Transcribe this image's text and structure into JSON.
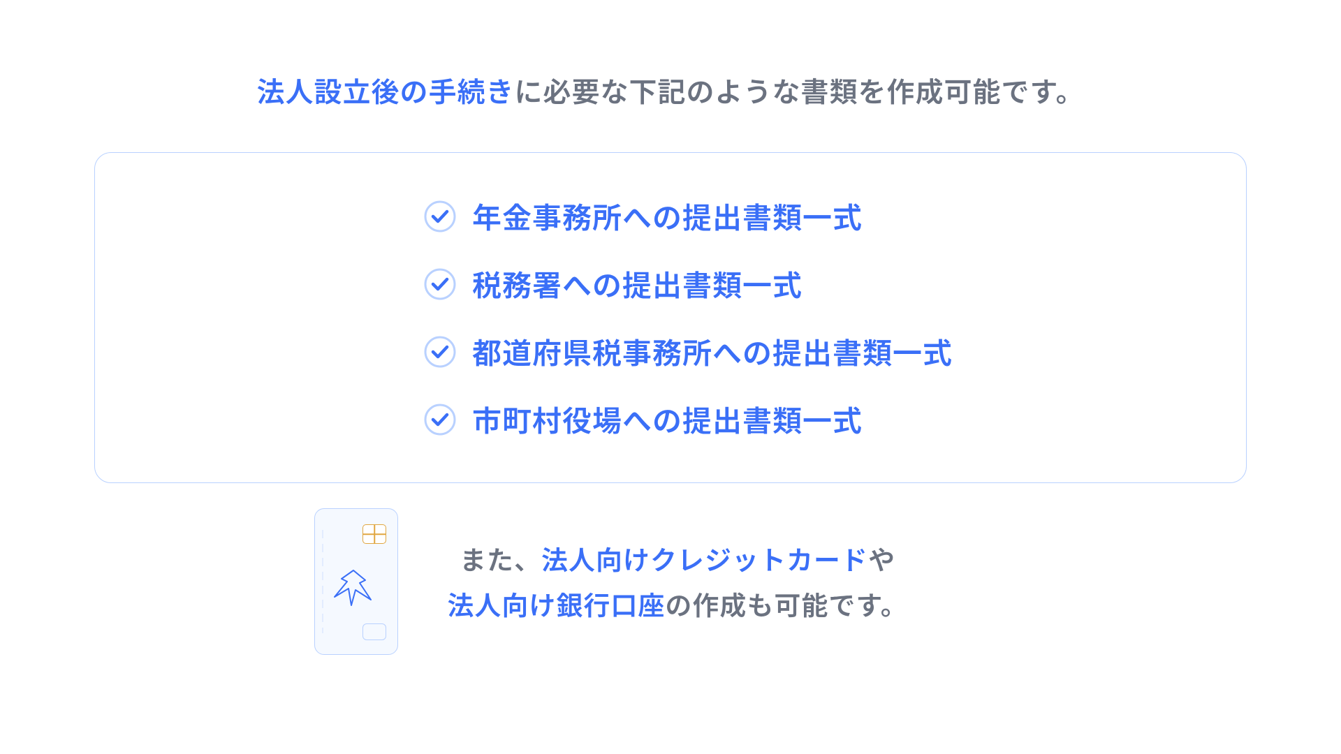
{
  "heading": {
    "part1": "法人設立後の手続き",
    "part2": "に必要な下記のような書類を作成可能です。"
  },
  "items": [
    "年金事務所への提出書類一式",
    "税務署への提出書類一式",
    "都道府県税事務所への提出書類一式",
    "市町村役場への提出書類一式"
  ],
  "bottom": {
    "part1": "また、",
    "part2": "法人向けクレジットカード",
    "part3": "や",
    "part4": "法人向け銀行口座",
    "part5": "の作成も可能です。"
  },
  "colors": {
    "blue": "#3a6ff7",
    "gray": "#6b7280",
    "border": "#b9d1ff"
  }
}
